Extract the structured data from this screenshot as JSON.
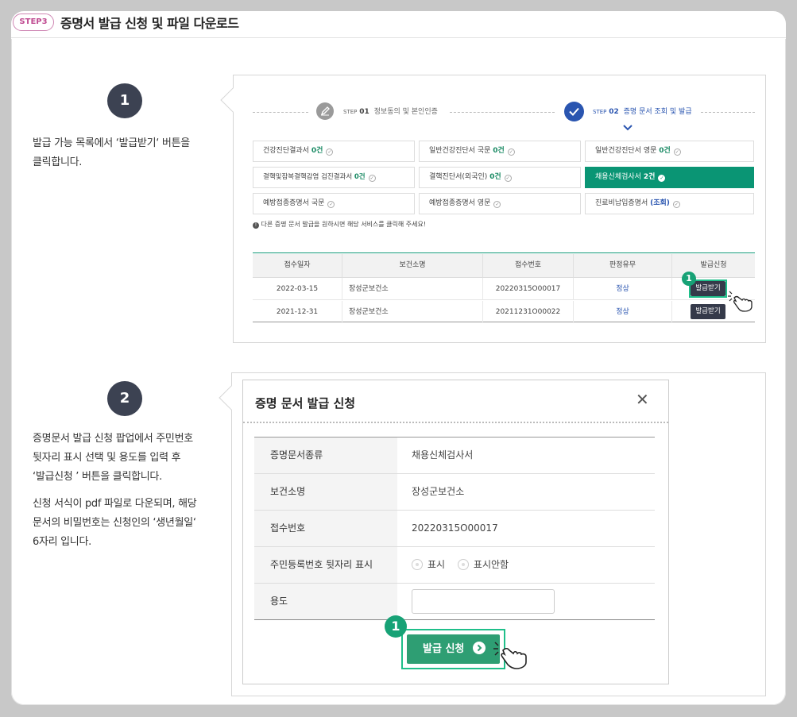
{
  "header": {
    "step_badge": "STEP3",
    "title": "증명서 발급 신청 및 파일 다운로드"
  },
  "section1": {
    "number": "1",
    "desc_lines": [
      "발급 가능 목록에서 ‘발급받기‘ 버튼을",
      "클릭합니다."
    ],
    "steps": [
      {
        "prefix": "STEP",
        "num": "01",
        "label": "정보동의 및 본인인증"
      },
      {
        "prefix": "STEP",
        "num": "02",
        "label": "증명 문서 조회 및 발급"
      }
    ],
    "certs": [
      {
        "name": "건강진단결과서",
        "count": "0건"
      },
      {
        "name": "일반건강진단서 국문",
        "count": "0건"
      },
      {
        "name": "일반건강진단서 영문",
        "count": "0건"
      },
      {
        "name": "결핵및잠복결핵감염 검진결과서",
        "count": "0건"
      },
      {
        "name": "결핵진단서(외국인)",
        "count": "0건"
      },
      {
        "name": "채용신체검사서",
        "count": "2건"
      },
      {
        "name": "예방접종증명서 국문",
        "count": ""
      },
      {
        "name": "예방접종증명서 영문",
        "count": ""
      },
      {
        "name": "진료비납입증명서",
        "count": "(조회)"
      }
    ],
    "notice": "다른 증명 문서 발급을 원하시면 해당 서비스를 클릭해 주세요!",
    "table": {
      "headers": [
        "접수일자",
        "보건소명",
        "접수번호",
        "판정유무",
        "발급신청"
      ],
      "rows": [
        {
          "date": "2022-03-15",
          "center": "장성군보건소",
          "receipt": "20220315O00017",
          "result": "정상",
          "action": "발급받기"
        },
        {
          "date": "2021-12-31",
          "center": "장성군보건소",
          "receipt": "20211231O00022",
          "result": "정상",
          "action": "발급받기"
        }
      ]
    },
    "callout": "1"
  },
  "section2": {
    "number": "2",
    "desc_p1": [
      "증명문서 발급 신청 팝업에서 주민번호",
      "뒷자리 표시 선택 및 용도를 입력 후",
      "‘발급신청 ’ 버튼을 클릭합니다."
    ],
    "desc_p2": [
      "신청 서식이 pdf 파일로 다운되며, 해당",
      "문서의 비밀번호는 신청인의 ‘생년월일‘",
      "6자리 입니다."
    ],
    "modal": {
      "title": "증명 문서 발급 신청",
      "close": "✕",
      "rows": [
        {
          "label": "증명문서종류",
          "value": "채용신체검사서"
        },
        {
          "label": "보건소명",
          "value": "장성군보건소"
        },
        {
          "label": "접수번호",
          "value": "20220315O00017"
        },
        {
          "label": "주민등록번호 뒷자리 표시",
          "value": ""
        },
        {
          "label": "용도",
          "value": ""
        }
      ],
      "radio_show": "표시",
      "radio_hide": "표시안함",
      "purpose_value": "",
      "submit": "발급 신청",
      "callout": "1"
    }
  },
  "colors": {
    "accent": "#0a9574",
    "step_pink": "#c04c92",
    "dark": "#3c4252",
    "step_blue": "#2a55b0"
  },
  "icons": [
    "edit-icon",
    "check-circle-icon",
    "chevron-down-icon",
    "info-icon",
    "hand-pointer-icon",
    "close-icon",
    "arrow-right-circle-icon"
  ]
}
